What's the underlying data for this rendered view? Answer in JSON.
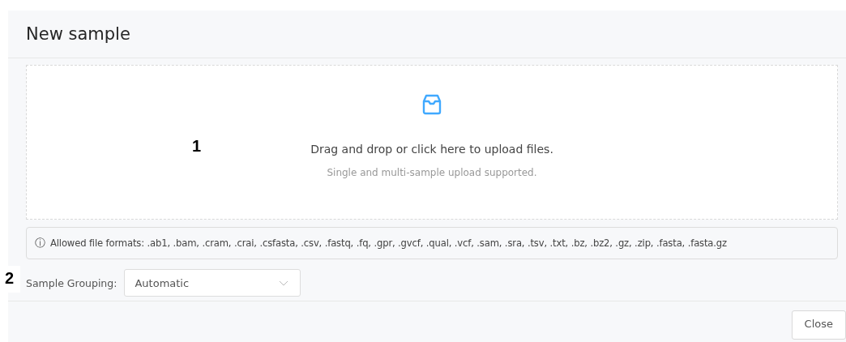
{
  "dialog": {
    "title": "New sample"
  },
  "upload": {
    "marker": "1",
    "prompt": "Drag and drop or click here to upload files.",
    "hint": "Single and multi-sample upload supported."
  },
  "alert": {
    "icon": "ⓘ",
    "text": "Allowed file formats: .ab1, .bam, .cram, .crai, .csfasta, .csv, .fastq, .fq, .gpr, .gvcf, .qual, .vcf, .sam, .sra, .tsv, .txt, .bz, .bz2, .gz, .zip, .fasta, .fasta.gz"
  },
  "grouping": {
    "marker": "2",
    "label": "Sample Grouping:",
    "value": "Automatic"
  },
  "buttons": [
    "Close"
  ]
}
